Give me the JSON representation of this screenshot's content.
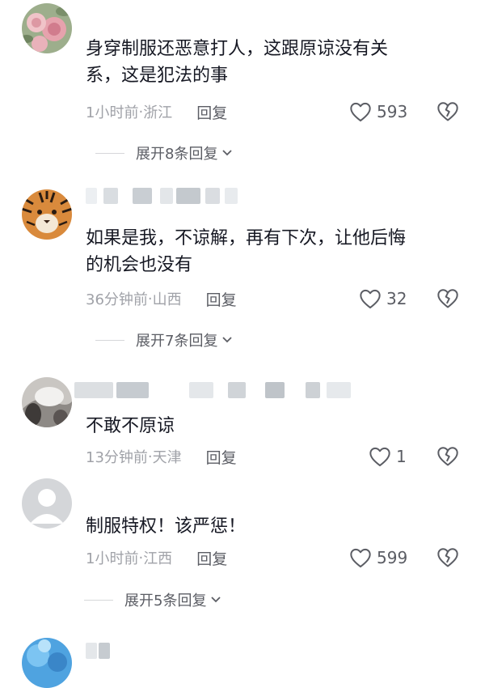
{
  "comments": [
    {
      "text": "身穿制服还恶意打人，这跟原谅没有关\n系，这是犯法的事",
      "time": "1小时前",
      "location": "浙江",
      "reply_label": "回复",
      "likes": "593",
      "expand_label": "展开8条回复"
    },
    {
      "text": "如果是我，不谅解，再有下次，让他后悔\n的机会也没有",
      "time": "36分钟前",
      "location": "山西",
      "reply_label": "回复",
      "likes": "32",
      "expand_label": "展开7条回复"
    },
    {
      "text": "不敢不原谅",
      "time": "13分钟前",
      "location": "天津",
      "reply_label": "回复",
      "likes": "1"
    },
    {
      "text": "制服特权！该严惩！",
      "time": "1小时前",
      "location": "江西",
      "reply_label": "回复",
      "likes": "599",
      "expand_label": "展开5条回复"
    }
  ],
  "meta_separator": " · ",
  "icons": {
    "like": "heart-outline-icon",
    "dislike": "broken-heart-icon",
    "expand": "chevron-down-icon"
  },
  "colors": {
    "text": "#161823",
    "meta": "#a0a2a8",
    "action": "#5b5d64"
  }
}
